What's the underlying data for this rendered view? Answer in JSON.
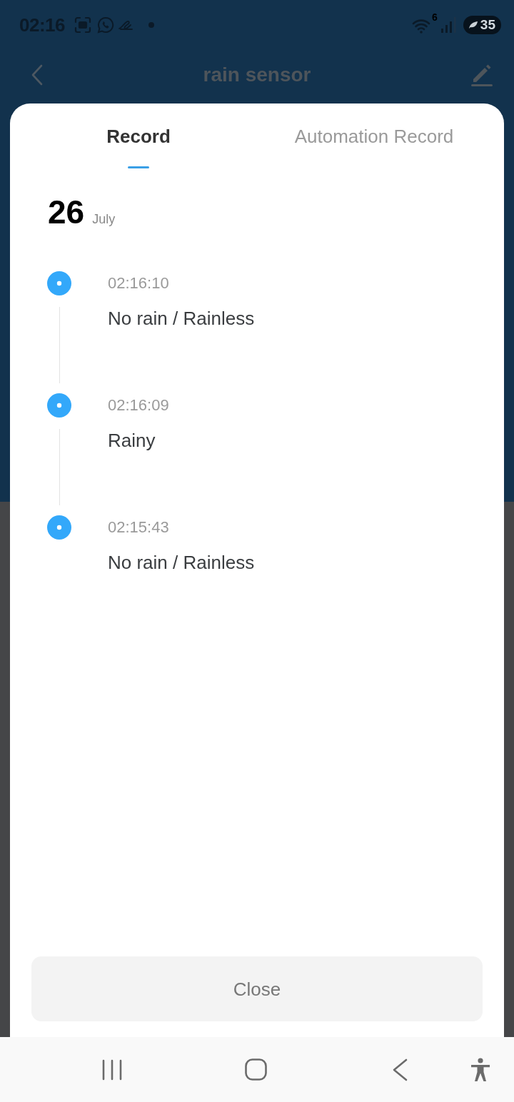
{
  "status_bar": {
    "time": "02:16",
    "wifi_badge": "6",
    "battery": "35"
  },
  "app_bar": {
    "title": "rain sensor"
  },
  "sheet": {
    "tabs": [
      {
        "label": "Record",
        "selected": true
      },
      {
        "label": "Automation Record",
        "selected": false
      }
    ],
    "date": {
      "day": "26",
      "month": "July"
    },
    "records": [
      {
        "time": "02:16:10",
        "text": "No rain / Rainless"
      },
      {
        "time": "02:16:09",
        "text": "Rainy"
      },
      {
        "time": "02:15:43",
        "text": "No rain / Rainless"
      }
    ],
    "close_button": "Close"
  }
}
